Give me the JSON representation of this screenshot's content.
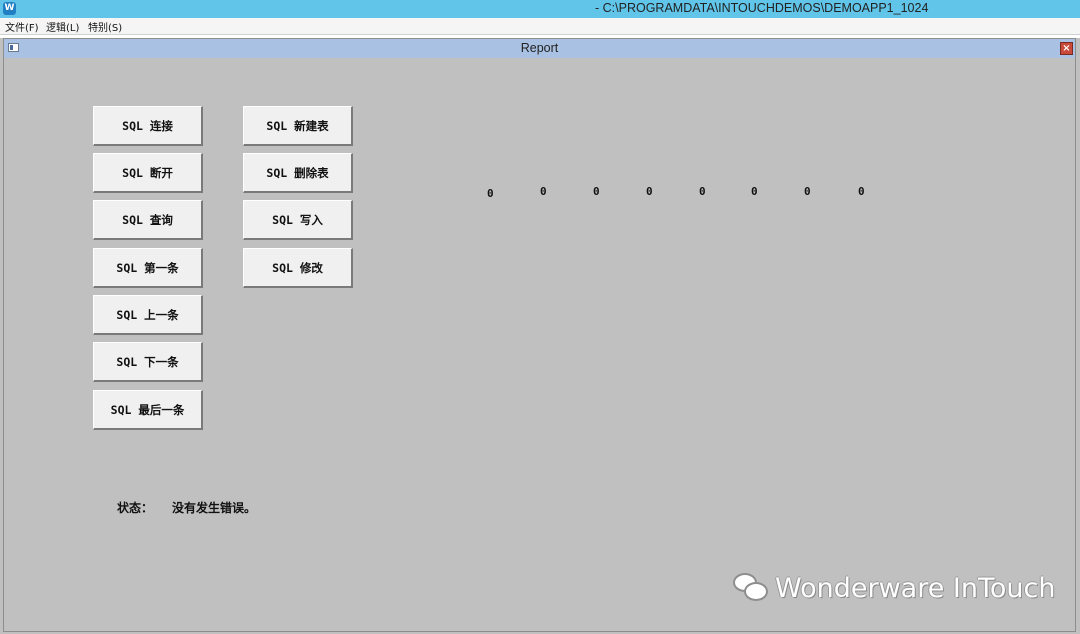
{
  "titlebar": {
    "title": "- C:\\PROGRAMDATA\\INTOUCHDEMOS\\DEMOAPP1_1024"
  },
  "menu": {
    "items": [
      "文件(F)",
      "逻辑(L)",
      "特别(S)"
    ]
  },
  "window": {
    "title": "Report",
    "close_label": "×"
  },
  "buttons": {
    "connect": "SQL 连接",
    "disconnect": "SQL 断开",
    "query": "SQL 查询",
    "first": "SQL 第一条",
    "prev": "SQL 上一条",
    "next": "SQL 下一条",
    "last": "SQL 最后一条",
    "create_table": "SQL 新建表",
    "drop_table": "SQL 删除表",
    "insert": "SQL 写入",
    "update": "SQL 修改"
  },
  "values": [
    "0",
    "0",
    "0",
    "0",
    "0",
    "0",
    "0",
    "0"
  ],
  "status": {
    "label": "状态：",
    "text": "没有发生错误。"
  },
  "watermark": {
    "text": "Wonderware InTouch",
    "icon": "wechat-icon"
  }
}
